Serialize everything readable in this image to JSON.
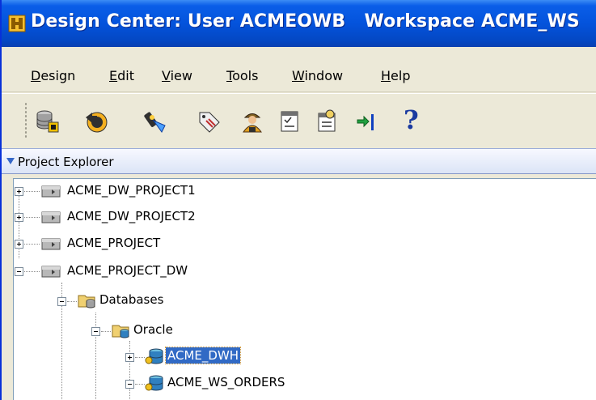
{
  "window": {
    "title": "Design Center: User ACMEOWB   Workspace ACME_WS"
  },
  "menu": [
    {
      "label": "Design",
      "accel": "D",
      "rest": "esign"
    },
    {
      "label": "Edit",
      "accel": "E",
      "rest": "dit"
    },
    {
      "label": "View",
      "accel": "V",
      "rest": "iew"
    },
    {
      "label": "Tools",
      "accel": "T",
      "rest": "ools"
    },
    {
      "label": "Window",
      "accel": "W",
      "rest": "indow"
    },
    {
      "label": "Help",
      "accel": "H",
      "rest": "elp"
    }
  ],
  "toolbar": {
    "buttons": [
      {
        "icon": "database-icon"
      },
      {
        "icon": "undo-icon"
      },
      {
        "icon": "flashlight-icon"
      },
      {
        "icon": "tag-icon"
      },
      {
        "icon": "user-icon"
      },
      {
        "icon": "properties-icon"
      },
      {
        "icon": "properties-alt-icon"
      },
      {
        "icon": "goto-end-icon"
      },
      {
        "icon": "help-icon",
        "glyph": "?"
      }
    ]
  },
  "project_explorer": {
    "title": "Project Explorer",
    "tree": [
      {
        "label": "ACME_DW_PROJECT1",
        "level": 0,
        "expanded": false,
        "icon": "project-icon"
      },
      {
        "label": "ACME_DW_PROJECT2",
        "level": 0,
        "expanded": false,
        "icon": "project-icon"
      },
      {
        "label": "ACME_PROJECT",
        "level": 0,
        "expanded": false,
        "icon": "project-icon"
      },
      {
        "label": "ACME_PROJECT_DW",
        "level": 0,
        "expanded": true,
        "icon": "project-icon"
      },
      {
        "label": "Databases",
        "level": 1,
        "expanded": true,
        "icon": "databases-folder-icon"
      },
      {
        "label": "Oracle",
        "level": 2,
        "expanded": true,
        "icon": "oracle-folder-icon"
      },
      {
        "label": "ACME_DWH",
        "level": 3,
        "expanded": false,
        "icon": "module-icon",
        "selected": true
      },
      {
        "label": "ACME_WS_ORDERS",
        "level": 3,
        "expanded": true,
        "icon": "module-icon"
      }
    ]
  },
  "colors": {
    "titlebar": "#0453dc",
    "selection": "#316ac5",
    "panel_border": "#7f9db9"
  }
}
